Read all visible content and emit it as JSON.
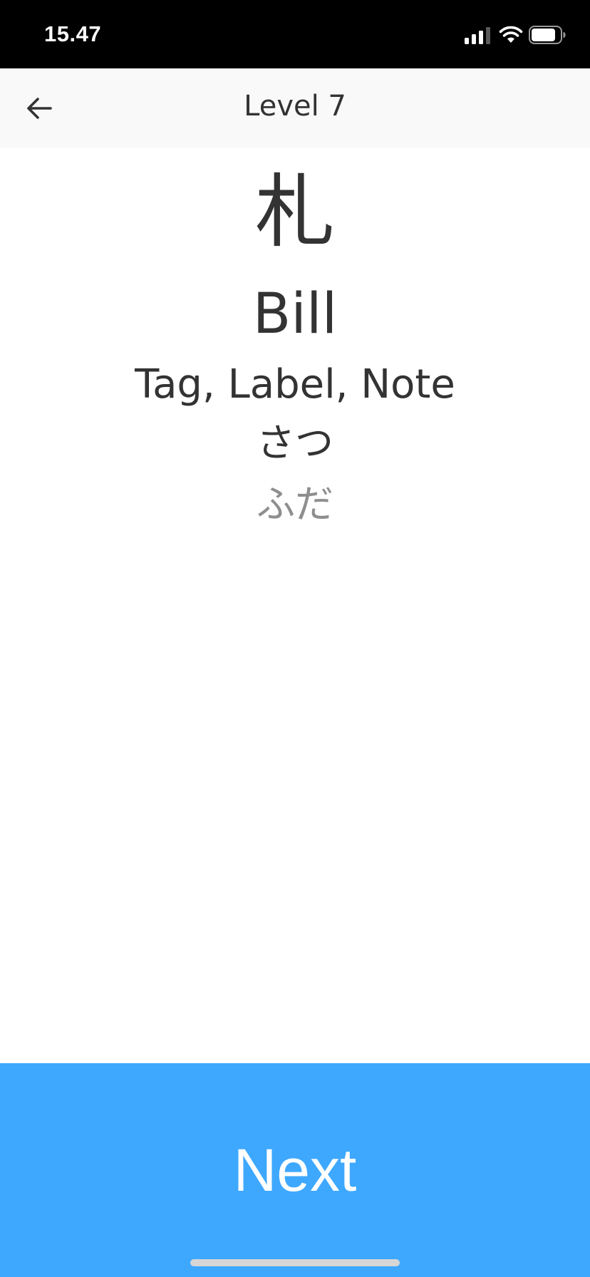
{
  "status_bar": {
    "time": "15.47",
    "icons": [
      "cellular-signal-icon",
      "wifi-icon",
      "battery-icon"
    ]
  },
  "nav": {
    "title": "Level 7",
    "back_icon": "arrow-left-icon"
  },
  "card": {
    "kanji": "札",
    "primary_meaning": "Bill",
    "other_meanings": "Tag, Label, Note",
    "onyomi": "さつ",
    "kunyomi": "ふだ"
  },
  "actions": {
    "next_label": "Next"
  },
  "colors": {
    "status_bar_bg": "#000000",
    "nav_bg": "#f9f9f9",
    "text_primary": "#333333",
    "text_muted": "#8e8e8e",
    "accent": "#3ea8ff"
  }
}
